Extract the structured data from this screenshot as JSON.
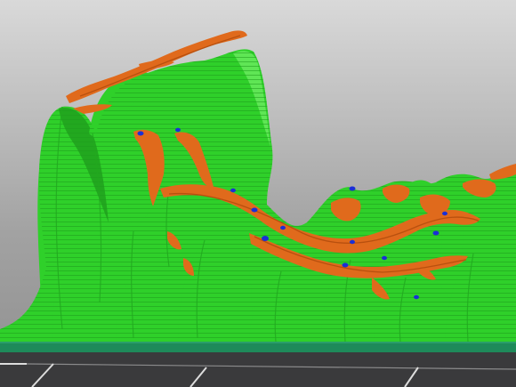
{
  "viewer": {
    "view": "3d-preview",
    "background_gradient": [
      "#d9d9d9",
      "#a2a2a2",
      "#8f8f8f"
    ],
    "bed_color": "#3a3a3c",
    "bed_grid_color": "#dcdcdc",
    "bed_edge_color": "#1e8a5a"
  },
  "feature_colors": {
    "perimeter": "#2fd02a",
    "perimeter_shade": "#22a81f",
    "perimeter_highlight": "#5fe655",
    "support_material": "#e06a1c",
    "support_shade": "#b8500f",
    "interface": "#1a2fd6"
  }
}
